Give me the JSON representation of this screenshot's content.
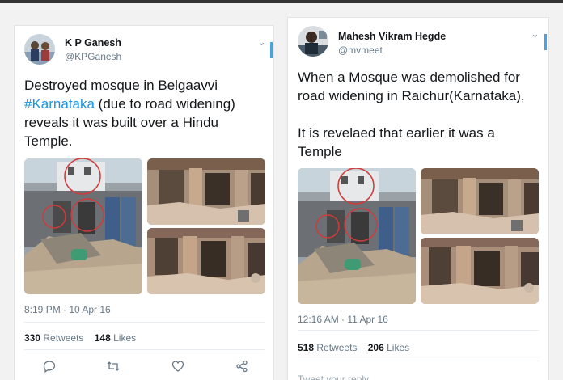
{
  "tweets": [
    {
      "author_name": "K P Ganesh",
      "handle": "@KPGanesh",
      "text_before": "Destroyed mosque in Belgaavvi\n",
      "hashtag": "#Karnataka",
      "text_after": " (due to road widening)\nreveals it was built over a Hindu\nTemple.",
      "timestamp": "8:19 PM · 10 Apr 16",
      "retweets": "330",
      "retweets_label": "Retweets",
      "likes": "148",
      "likes_label": "Likes"
    },
    {
      "author_name": "Mahesh Vikram Hegde",
      "handle": "@mvmeet",
      "text": "When a Mosque was demolished for\nroad widening in Raichur(Karnataka),\n\nIt is revelaed that earlier it was a\nTemple",
      "timestamp": "12:16 AM · 11 Apr 16",
      "retweets": "518",
      "retweets_label": "Retweets",
      "likes": "206",
      "likes_label": "Likes",
      "reply_placeholder": "Tweet your reply"
    }
  ],
  "icons": {
    "chevron": "chevron-down-icon",
    "reply": "reply-icon",
    "retweet": "retweet-icon",
    "like": "heart-icon",
    "share": "share-icon"
  },
  "colors": {
    "link": "#1b95e0",
    "muted": "#657786",
    "accent_bar": "#4aa3df"
  }
}
